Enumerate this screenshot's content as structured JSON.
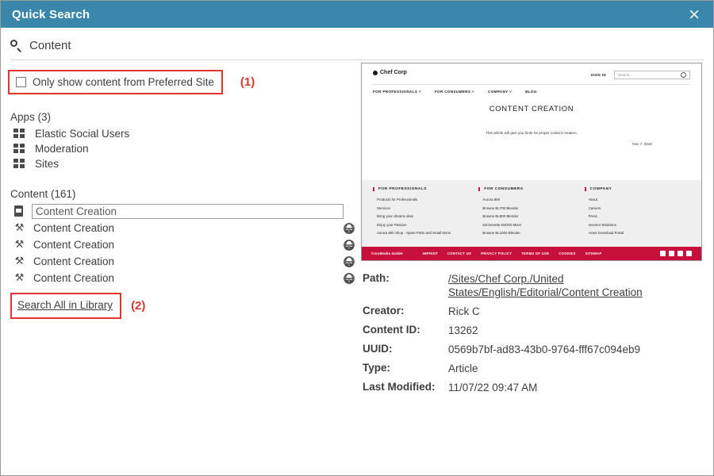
{
  "window": {
    "title": "Quick Search",
    "close_label": "×",
    "header_color": "#3b87ab",
    "callout_color": "#e0352c"
  },
  "search": {
    "icon": "search-icon",
    "term": "Content"
  },
  "preferred": {
    "checkbox_label": "Only show content from Preferred Site",
    "checked": false,
    "callout": "(1)"
  },
  "apps": {
    "heading_label": "Apps",
    "heading_count": "(3)",
    "heading": "Apps (3)",
    "items": [
      {
        "label": "Elastic Social Users",
        "icon": "grid-icon"
      },
      {
        "label": "Moderation",
        "icon": "grid-icon"
      },
      {
        "label": "Sites",
        "icon": "grid-icon"
      }
    ]
  },
  "content": {
    "heading_label": "Content",
    "heading_count": "(161)",
    "heading": "Content (161)",
    "input_value": "Content Creation",
    "input_icon": "document-icon",
    "rows": [
      {
        "label": "Content Creation",
        "icon": "tools-icon",
        "trailing_icon": "globe-icon"
      },
      {
        "label": "Content Creation",
        "icon": "tools-icon",
        "trailing_icon": "globe-icon"
      },
      {
        "label": "Content Creation",
        "icon": "tools-icon",
        "trailing_icon": "globe-icon"
      },
      {
        "label": "Content Creation",
        "icon": "tools-icon",
        "trailing_icon": "globe-icon"
      }
    ],
    "search_all_label": "Search All in Library",
    "search_all_callout": "(2)"
  },
  "preview": {
    "brand": "Chef Corp",
    "signin": "SIGN IN",
    "search_placeholder": "Search...",
    "nav": [
      "FOR PROFESSIONALS ˅",
      "FOR CONSUMERS ˅",
      "COMPANY ˅",
      "BLOG"
    ],
    "article_title": "CONTENT CREATION",
    "article_body": "This article will give you hints for proper content creation.",
    "article_date": "Nov 7, 2022",
    "footer_columns": [
      {
        "head": "FOR PROFESSIONALS",
        "links": [
          "Products for Professionals",
          "Services",
          "Bring your dreams alive",
          "Enjoy your Passion",
          "Aurora 800 Shop - Spare Parts and Small Items"
        ]
      },
      {
        "head": "FOR CONSUMERS",
        "links": [
          "Aurora 800",
          "Browne BL700 Blender",
          "Browne BL900 Blender",
          "Kitchenette KM200 Mixer",
          "Browne BL1000 Blender"
        ]
      },
      {
        "head": "COMPANY",
        "links": [
          "About",
          "Careers",
          "Press",
          "Investor Relations",
          "Asset Download Portal"
        ]
      }
    ],
    "copyright": "CoreMedia GmbH",
    "legal_links": [
      "IMPRINT",
      "CONTACT US",
      "PRIVACY POLICY",
      "TERMS OF USE",
      "COOKIES",
      "SITEMAP"
    ],
    "social": [
      "facebook-icon",
      "linkedin-icon",
      "twitter-icon",
      "youtube-icon"
    ],
    "accent_color": "#c8103c"
  },
  "meta": {
    "rows": [
      {
        "key": "Path:",
        "value": "/Sites/Chef Corp./United States/English/Editorial/Content Creation",
        "link": true
      },
      {
        "key": "Creator:",
        "value": "Rick C",
        "link": false
      },
      {
        "key": "Content ID:",
        "value": "13262",
        "link": false
      },
      {
        "key": "UUID:",
        "value": "0569b7bf-ad83-43b0-9764-fff67c094eb9",
        "link": false
      },
      {
        "key": "Type:",
        "value": "Article",
        "link": false
      },
      {
        "key": "Last Modified:",
        "value": "11/07/22 09:47 AM",
        "link": false
      }
    ]
  }
}
